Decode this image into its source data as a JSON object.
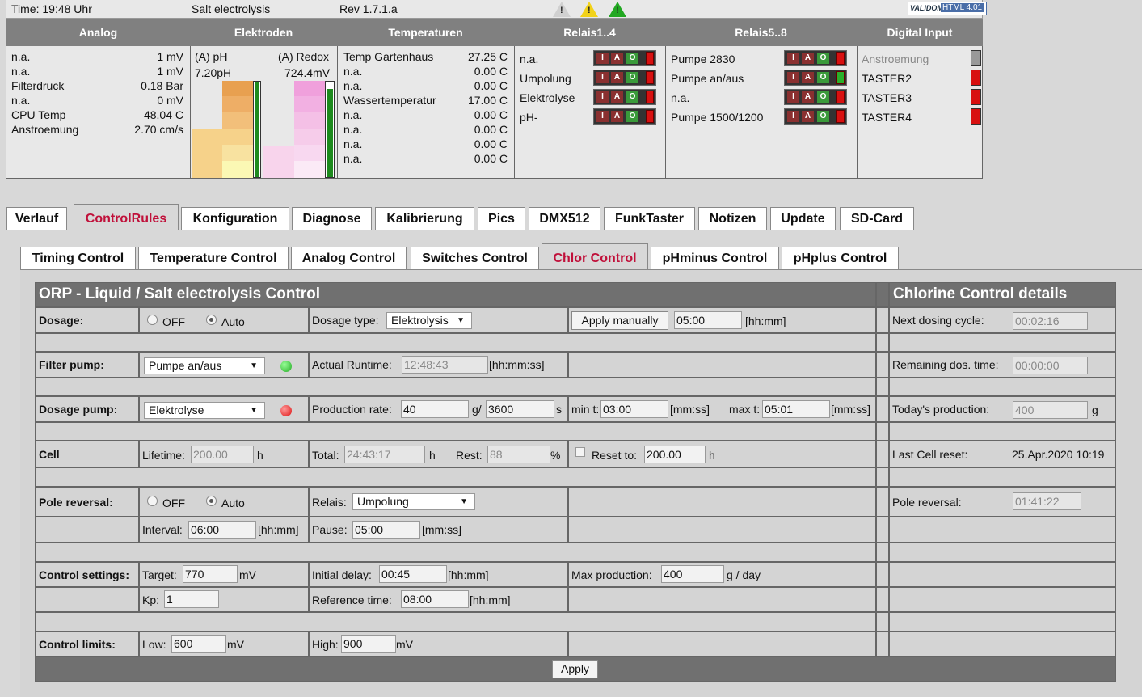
{
  "top": {
    "time": "Time: 19:48 Uhr",
    "title": "Salt electrolysis",
    "rev": "Rev 1.7.1.a",
    "validome_a": "VALIDOME",
    "validome_b": "HTML 4.01"
  },
  "panel": {
    "headers": [
      "Analog",
      "Elektroden",
      "Temperaturen",
      "Relais1..4",
      "Relais5..8",
      "Digital Input"
    ],
    "analog": [
      [
        "n.a.",
        "1 mV"
      ],
      [
        "n.a.",
        "1 mV"
      ],
      [
        "Filterdruck",
        "0.18 Bar"
      ],
      [
        "n.a.",
        "0 mV"
      ],
      [
        "CPU Temp",
        "48.04 C"
      ],
      [
        "Anstroemung",
        "2.70 cm/s"
      ]
    ],
    "elektroden": {
      "ph_label": "(A) pH",
      "ph_value": "7.20pH",
      "redox_label": "(A) Redox",
      "redox_value": "724.4mV",
      "ph_level": 0.99,
      "redox_level": 0.92
    },
    "temps": [
      [
        "Temp Gartenhaus",
        "27.25 C"
      ],
      [
        "n.a.",
        "0.00 C"
      ],
      [
        "n.a.",
        "0.00 C"
      ],
      [
        "Wassertemperatur",
        "17.00 C"
      ],
      [
        "n.a.",
        "0.00 C"
      ],
      [
        "n.a.",
        "0.00 C"
      ],
      [
        "n.a.",
        "0.00 C"
      ],
      [
        "n.a.",
        "0.00 C"
      ]
    ],
    "relais1": [
      "n.a.",
      "Umpolung",
      "Elektrolyse",
      "pH-"
    ],
    "relais2": [
      "Pumpe 2830",
      "Pumpe an/aus",
      "n.a.",
      "Pumpe 1500/1200"
    ],
    "relais2_led": [
      "#d81010",
      "#2ab02a",
      "#d81010",
      "#d81010"
    ],
    "digital": [
      "Anstroemung",
      "TASTER2",
      "TASTER3",
      "TASTER4"
    ],
    "iao": {
      "i": "I",
      "a": "A",
      "o": "O"
    }
  },
  "tabs": [
    "Verlauf",
    "ControlRules",
    "Konfiguration",
    "Diagnose",
    "Kalibrierung",
    "Pics",
    "DMX512",
    "FunkTaster",
    "Notizen",
    "Update",
    "SD-Card"
  ],
  "subtabs": [
    "Timing Control",
    "Temperature Control",
    "Analog Control",
    "Switches Control",
    "Chlor Control",
    "pHminus Control",
    "pHplus Control"
  ],
  "form": {
    "title": "ORP - Liquid / Salt electrolysis Control",
    "details_title": "Chlorine Control details",
    "dosage": {
      "label": "Dosage:",
      "off": "OFF",
      "auto": "Auto",
      "type_label": "Dosage type:",
      "type_value": "Elektrolysis",
      "apply_manually": "Apply manually",
      "manual_time": "05:00",
      "unit": "[hh:mm]"
    },
    "filter": {
      "label": "Filter pump:",
      "value": "Pumpe an/aus",
      "runtime_label": "Actual Runtime:",
      "runtime": "12:48:43",
      "unit": "[hh:mm:ss]"
    },
    "dpump": {
      "label": "Dosage pump:",
      "value": "Elektrolyse",
      "rate_label": "Production rate:",
      "rate": "40",
      "g": "g/",
      "sec": "3600",
      "s": "s",
      "min_label": "min t:",
      "min": "03:00",
      "min_unit": "[mm:ss]",
      "max_label": "max t:",
      "max": "05:01",
      "max_unit": "[mm:ss]"
    },
    "cell": {
      "label": "Cell",
      "life_label": "Lifetime:",
      "life": "200.00",
      "h": "h",
      "total_label": "Total:",
      "total": "24:43:17",
      "h2": "h",
      "rest_label": "Rest:",
      "rest": "88",
      "pct": "%",
      "reset_label": "Reset to:",
      "reset": "200.00",
      "h3": "h"
    },
    "pole": {
      "label": "Pole reversal:",
      "off": "OFF",
      "auto": "Auto",
      "relais_label": "Relais:",
      "relais": "Umpolung",
      "interval_label": "Interval:",
      "interval": "06:00",
      "interval_unit": "[hh:mm]",
      "pause_label": "Pause:",
      "pause": "05:00",
      "pause_unit": "[mm:ss]"
    },
    "settings": {
      "label": "Control settings:",
      "target_label": "Target:",
      "target": "770",
      "mv": "mV",
      "delay_label": "Initial delay:",
      "delay": "00:45",
      "delay_unit": "[hh:mm]",
      "maxprod_label": "Max production:",
      "maxprod": "400",
      "maxprod_unit": "g / day",
      "kp_label": "Kp:",
      "kp": "1",
      "ref_label": "Reference time:",
      "ref": "08:00",
      "ref_unit": "[hh:mm]"
    },
    "limits": {
      "label": "Control limits:",
      "low_label": "Low:",
      "low": "600",
      "mv": "mV",
      "high_label": "High:",
      "high": "900",
      "mv2": "mV"
    },
    "apply": "Apply",
    "details": {
      "next_label": "Next dosing cycle:",
      "next": "00:02:16",
      "remain_label": "Remaining dos. time:",
      "remain": "00:00:00",
      "today_label": "Today's production:",
      "today": "400",
      "g": "g",
      "last_label": "Last Cell reset:",
      "last": "25.Apr.2020 10:19",
      "pole_label": "Pole reversal:",
      "pole": "01:41:22"
    }
  }
}
